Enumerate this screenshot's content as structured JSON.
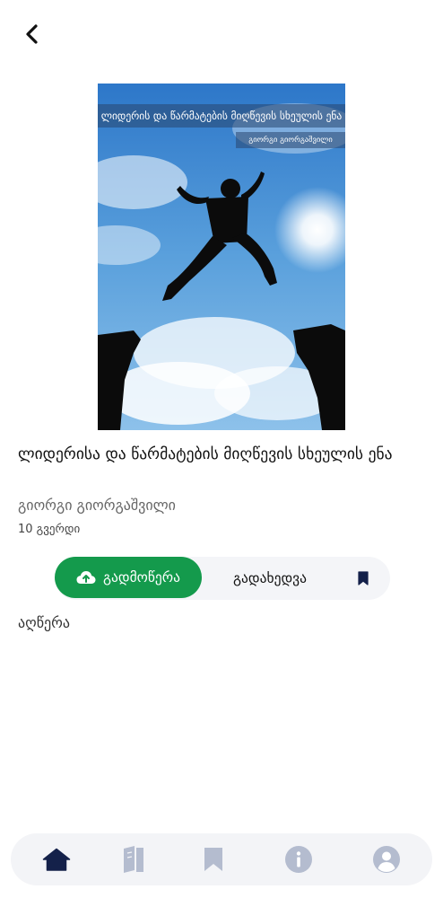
{
  "book": {
    "cover_title": "ლიდერის და წარმატების მიღწევის სხეულის ენა",
    "cover_author": "გიორგი გიორგაშვილი",
    "title": "ლიდერისა და წარმატების მიღწევის სხეულის ენა",
    "author": "გიორგი გიორგაშვილი",
    "pages": "10 გვერდი"
  },
  "actions": {
    "download_label": "გადმოწერა",
    "read_label": "გადახედვა"
  },
  "description": {
    "label": "აღწერა"
  },
  "icons": {
    "back": "chevron-left-icon",
    "download": "cloud-upload-icon",
    "bookmark": "bookmark-icon",
    "nav": [
      "home-icon",
      "book-icon",
      "bookmark-icon",
      "info-icon",
      "user-icon"
    ]
  },
  "colors": {
    "accent_green": "#149a4c",
    "nav_active": "#14214a",
    "nav_inactive": "#b4bccf",
    "nav_background": "#f3f4f7"
  }
}
